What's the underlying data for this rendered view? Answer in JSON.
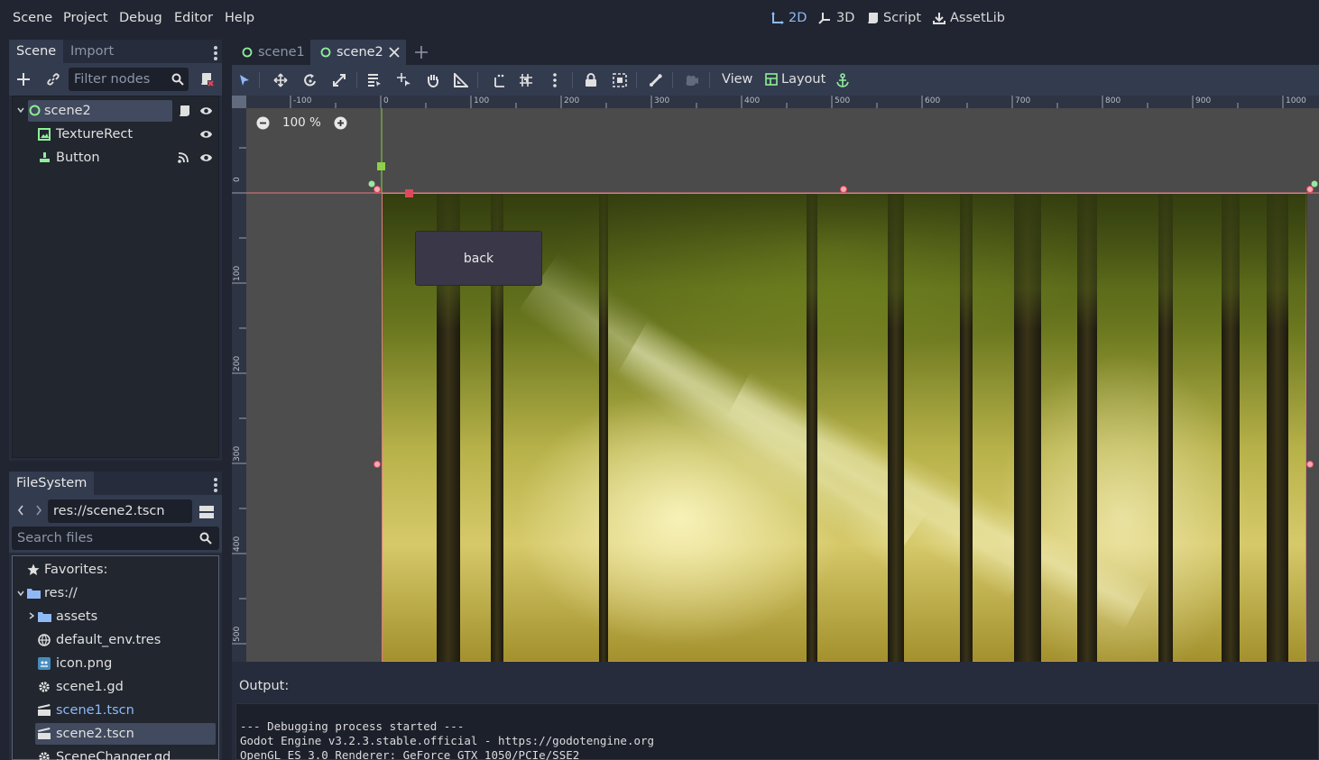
{
  "menu": {
    "items": [
      "Scene",
      "Project",
      "Debug",
      "Editor",
      "Help"
    ]
  },
  "main_tabs": [
    {
      "label": "2D",
      "icon": "2d-axis-icon",
      "active": true
    },
    {
      "label": "3D",
      "icon": "3d-axis-icon",
      "active": false
    },
    {
      "label": "Script",
      "icon": "script-icon",
      "active": false
    },
    {
      "label": "AssetLib",
      "icon": "download-icon",
      "active": false
    }
  ],
  "scene_dock": {
    "tabs": [
      "Scene",
      "Import"
    ],
    "active_tab": "Scene",
    "filter_placeholder": "Filter nodes",
    "tree": [
      {
        "label": "scene2",
        "icon": "control-node-icon",
        "selected": true,
        "actions": [
          "script-icon",
          "visibility-eye-icon"
        ]
      },
      {
        "label": "TextureRect",
        "icon": "texture-rect-icon",
        "selected": false,
        "actions": [
          "visibility-eye-icon"
        ]
      },
      {
        "label": "Button",
        "icon": "button-node-icon",
        "selected": false,
        "actions": [
          "signal-icon",
          "visibility-eye-icon"
        ]
      }
    ]
  },
  "filesystem_dock": {
    "tab": "FileSystem",
    "path": "res://scene2.tscn",
    "search_placeholder": "Search files",
    "tree": [
      {
        "label": "Favorites:",
        "icon": "star-icon"
      },
      {
        "label": "res://",
        "icon": "folder-icon"
      },
      {
        "label": "assets",
        "icon": "folder-icon"
      },
      {
        "label": "default_env.tres",
        "icon": "environment-icon"
      },
      {
        "label": "icon.png",
        "icon": "image-icon"
      },
      {
        "label": "scene1.gd",
        "icon": "gear-icon"
      },
      {
        "label": "scene1.tscn",
        "icon": "clapper-icon"
      },
      {
        "label": "scene2.tscn",
        "icon": "clapper-icon"
      },
      {
        "label": "SceneChanger.gd",
        "icon": "gear-icon"
      }
    ]
  },
  "scene_tabs": [
    {
      "label": "scene1",
      "active": false
    },
    {
      "label": "scene2",
      "active": true
    }
  ],
  "toolbar": {
    "view_label": "View",
    "layout_label": "Layout"
  },
  "viewport": {
    "zoom_label": "100 %",
    "ruler_h_labels": [
      "-100",
      "0",
      "100",
      "200",
      "300",
      "400",
      "500",
      "600",
      "700",
      "800",
      "900",
      "1000"
    ],
    "ruler_v_labels": [
      "0",
      "100",
      "200",
      "300",
      "400",
      "500"
    ],
    "button_text": "back"
  },
  "output": {
    "label": "Output:",
    "lines": [
      "--- Debugging process started ---",
      "Godot Engine v3.2.3.stable.official - https://godotengine.org",
      "OpenGL ES 3.0 Renderer: GeForce GTX 1050/PCIe/SSE2"
    ]
  },
  "colors": {
    "accent": "#8fb9f5",
    "node_green": "#8eef97",
    "selection_red": "#e0485a"
  }
}
